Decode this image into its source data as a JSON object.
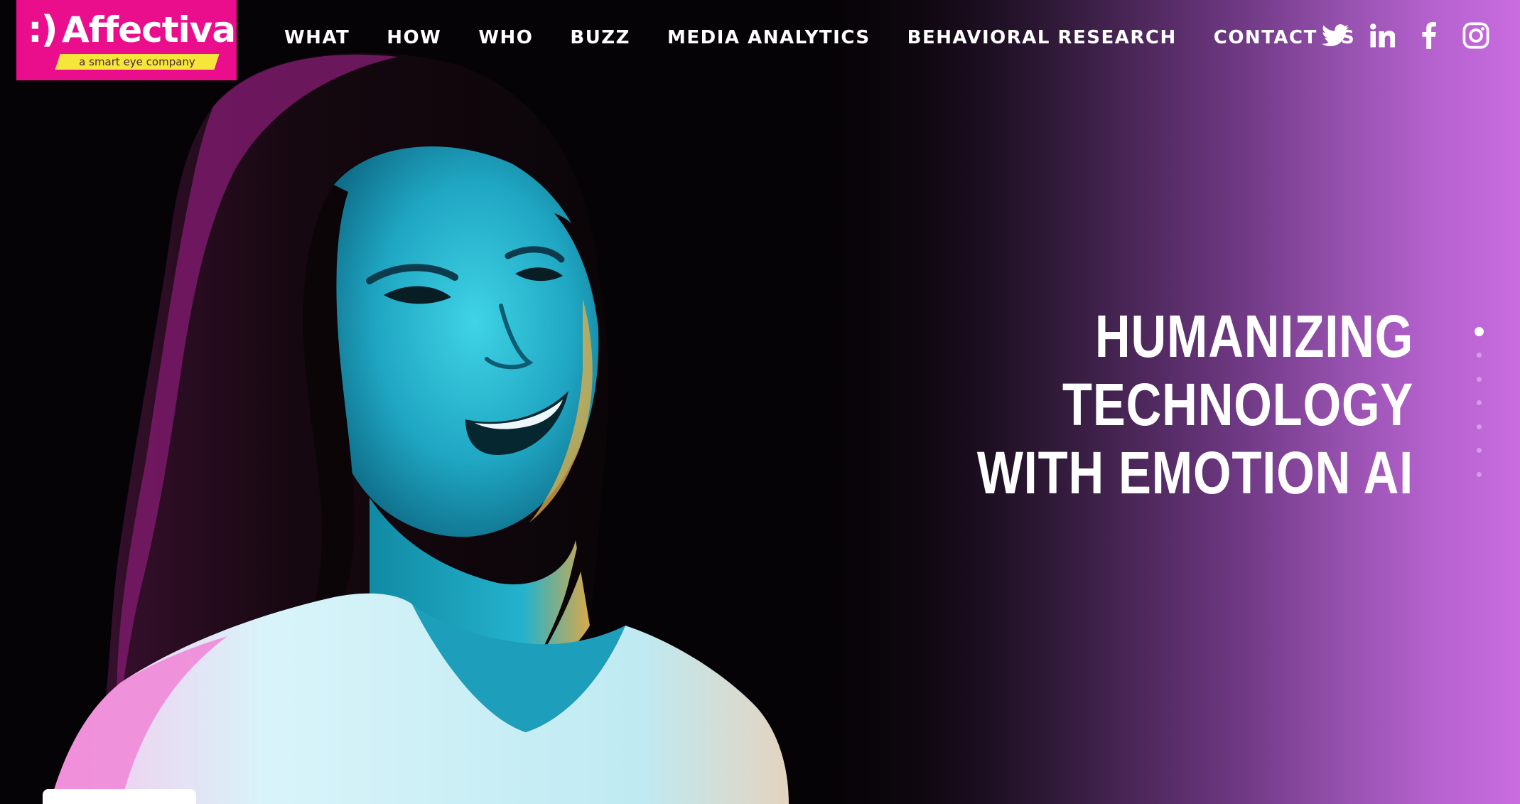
{
  "brand": {
    "smiley": ":)",
    "name": "Affectiva",
    "tagline": "a smart eye company",
    "primary_color": "#ea0d8c",
    "tag_color": "#f6e53a"
  },
  "nav": {
    "items": [
      {
        "label": "WHAT"
      },
      {
        "label": "HOW"
      },
      {
        "label": "WHO"
      },
      {
        "label": "BUZZ"
      },
      {
        "label": "MEDIA ANALYTICS"
      },
      {
        "label": "BEHAVIORAL RESEARCH"
      },
      {
        "label": "CONTACT US"
      }
    ]
  },
  "social": {
    "icons": [
      "twitter-icon",
      "linkedin-icon",
      "facebook-icon",
      "instagram-icon"
    ]
  },
  "hero": {
    "headline": {
      "line1": "HUMANIZING",
      "line2": "TECHNOLOGY",
      "line3": "WITH EMOTION AI"
    },
    "gradient_colors": [
      "#050305",
      "#c96ce0"
    ],
    "slides": {
      "count": 7,
      "active_index": 0
    }
  }
}
